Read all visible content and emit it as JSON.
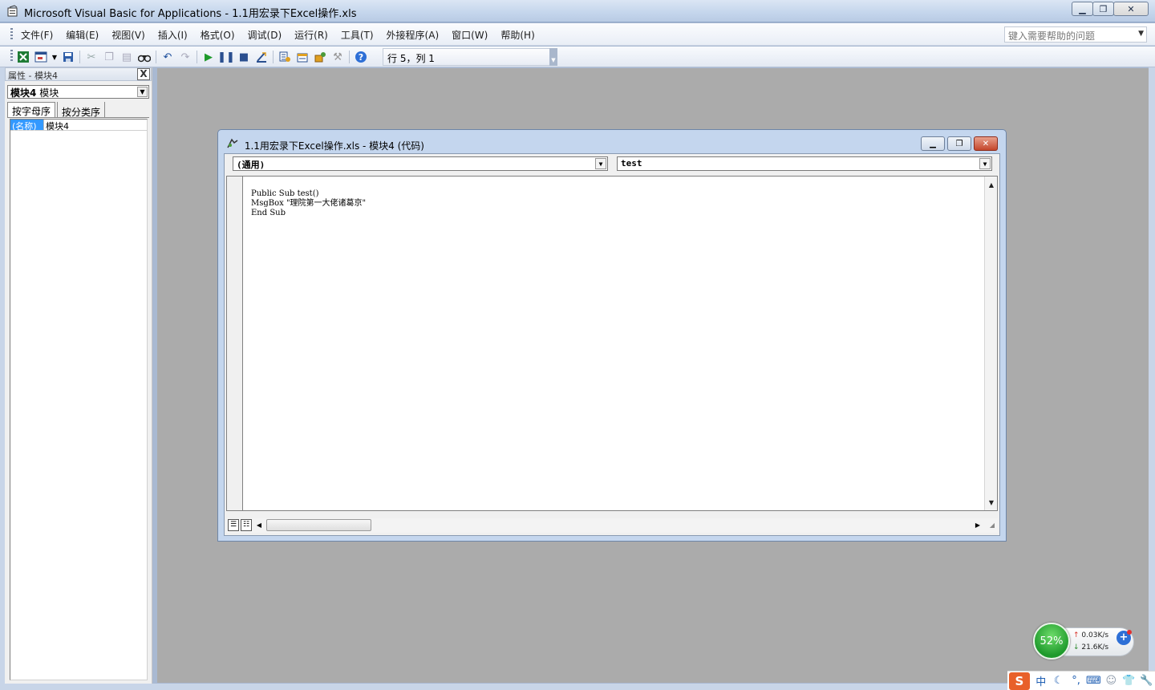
{
  "window": {
    "title": "Microsoft Visual Basic for Applications - 1.1用宏录下Excel操作.xls",
    "minimize_glyph": "▁",
    "maximize_glyph": "❐",
    "close_glyph": "✕"
  },
  "menubar": {
    "items": [
      "文件(F)",
      "编辑(E)",
      "视图(V)",
      "插入(I)",
      "格式(O)",
      "调试(D)",
      "运行(R)",
      "工具(T)",
      "外接程序(A)",
      "窗口(W)",
      "帮助(H)"
    ],
    "help_placeholder": "键入需要帮助的问题"
  },
  "toolbar": {
    "position_text": "行 5，列 1"
  },
  "properties": {
    "header": "属性 - 模块4",
    "close_glyph": "X",
    "object_bold": "模块4",
    "object_type": "模块",
    "tabs": [
      "按字母序",
      "按分类序"
    ],
    "rows": [
      {
        "name": "(名称)",
        "value": "模块4"
      }
    ]
  },
  "code_window": {
    "title": "1.1用宏录下Excel操作.xls - 模块4 (代码)",
    "object_dropdown": "(通用)",
    "procedure_dropdown": "test",
    "code_lines": [
      "Public Sub test()",
      "MsgBox \"理院第一大佬诸葛京\"",
      "End Sub"
    ]
  },
  "net_monitor": {
    "percent": "52%",
    "upload": "0.03K/s",
    "download": "21.6K/s"
  },
  "ime": {
    "logo": "S",
    "mode": "中"
  },
  "colors": {
    "accent_blue": "#3399ff",
    "mdi_background": "#ababab",
    "net_green": "#1f9a2c"
  }
}
